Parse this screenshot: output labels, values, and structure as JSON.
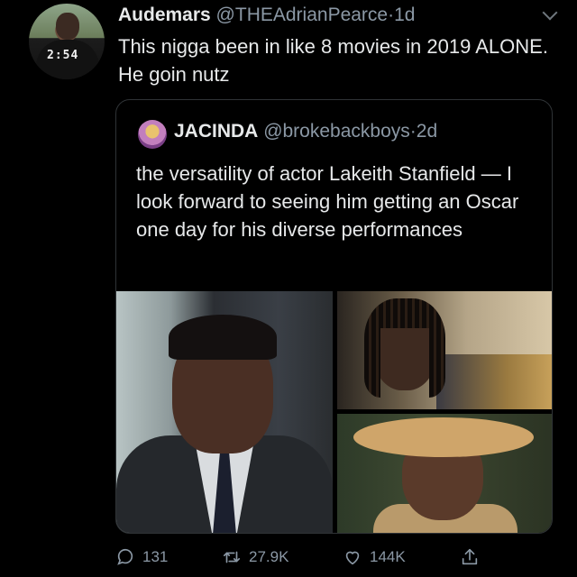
{
  "tweet": {
    "author_name": "Audemars",
    "author_handle": "@THEAdrianPearce",
    "separator": "·",
    "time": "1d",
    "text": "This nigga been in like 8 movies in 2019 ALONE. He goin nutz",
    "avatar_shirt_text": "2:54"
  },
  "quoted_tweet": {
    "author_name": "JACINDA",
    "author_handle": "@brokebackboys",
    "separator": "·",
    "time": "2d",
    "text": "the versatility of actor Lakeith Stanfield — I look forward to seeing him getting an Oscar one day for his diverse performances"
  },
  "actions": {
    "replies": "131",
    "retweets": "27.9K",
    "likes": "144K"
  },
  "icons": {
    "reply": "reply-icon",
    "retweet": "retweet-icon",
    "like": "heart-icon",
    "share": "share-icon",
    "menu": "chevron-down-icon"
  }
}
